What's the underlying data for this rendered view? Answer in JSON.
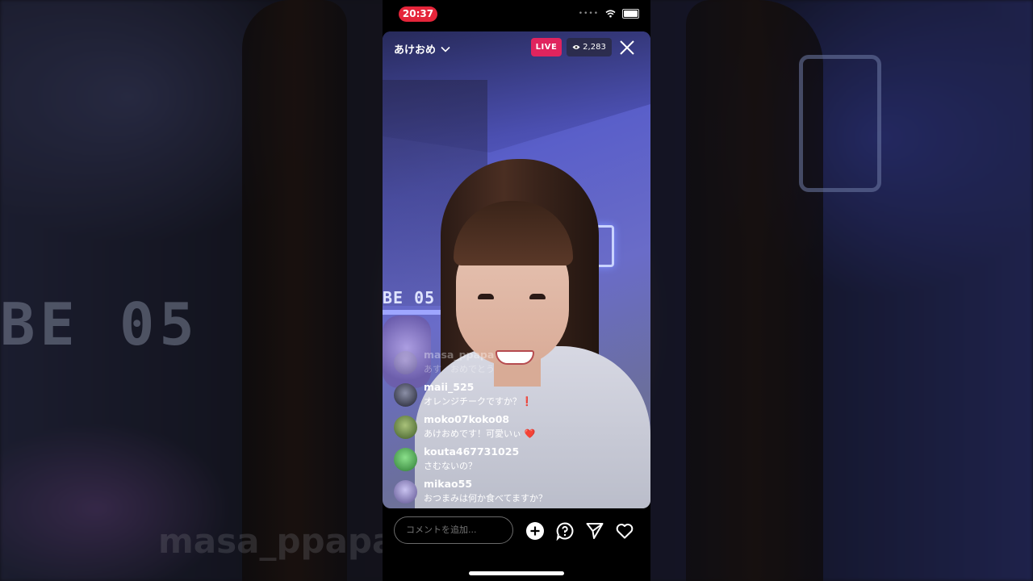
{
  "status_bar": {
    "time": "20:37"
  },
  "live": {
    "username": "あけおめ",
    "live_label": "LIVE",
    "viewer_count": "2,283"
  },
  "comments": [
    {
      "user": "masa_ppapa",
      "text": "あす　おめでとう"
    },
    {
      "user": "maii_525",
      "text": "オレンジチークですか？",
      "emoji": "❗"
    },
    {
      "user": "moko07koko08",
      "text": "あけおめです！可愛いぃ",
      "emoji": "❤️"
    },
    {
      "user": "kouta467731025",
      "text": "さむないの？"
    },
    {
      "user": "mikao55",
      "text": "おつまみは何か食べてますか？"
    }
  ],
  "bottom_bar": {
    "comment_placeholder": "コメントを追加..."
  },
  "background": {
    "clock_text": "BE 05",
    "blurred_name": "masa_ppapa"
  },
  "colors": {
    "live_badge": "#e0245e",
    "status_time_bg": "#e5253a",
    "neon_wall": "#5a5fc9"
  }
}
